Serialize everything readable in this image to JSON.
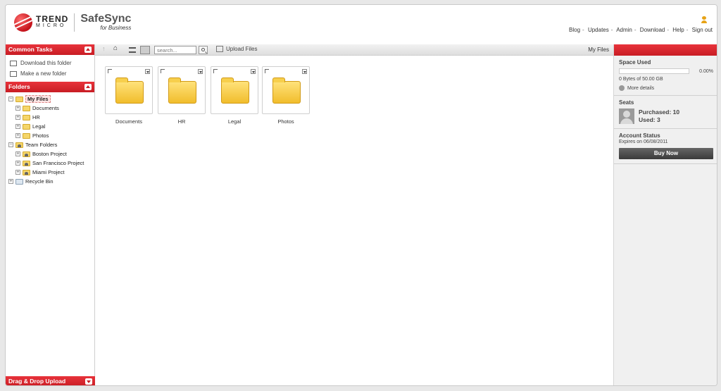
{
  "brand": {
    "name_top": "TREND",
    "name_bottom": "MICRO",
    "product": "SafeSync",
    "product_sub": "for Business"
  },
  "top_links": [
    "Blog",
    "Updates",
    "Admin",
    "Download",
    "Help",
    "Sign out"
  ],
  "common_tasks": {
    "title": "Common Tasks",
    "items": [
      "Download this folder",
      "Make a new folder"
    ]
  },
  "folders": {
    "title": "Folders",
    "my_files": "My Files",
    "my_files_children": [
      "Documents",
      "HR",
      "Legal",
      "Photos"
    ],
    "team_folders": "Team Folders",
    "team_children": [
      "Boston Project",
      "San Francisco Project",
      "Miami Project"
    ],
    "recycle_bin": "Recycle Bin"
  },
  "drag_drop": "Drag & Drop Upload",
  "toolbar": {
    "search_placeholder": "search...",
    "upload_label": "Upload Files",
    "location": "My Files"
  },
  "files": [
    "Documents",
    "HR",
    "Legal",
    "Photos"
  ],
  "space": {
    "title": "Space Used",
    "percent": "0.00%",
    "percent_value": 0,
    "detail": "0 Bytes of 50.00 GB",
    "more": "More details"
  },
  "seats": {
    "title": "Seats",
    "purchased": "Purchased: 10",
    "used": "Used: 3"
  },
  "account": {
    "title": "Account Status",
    "expires": "Expires on 06/08/2011",
    "buy": "Buy Now"
  }
}
